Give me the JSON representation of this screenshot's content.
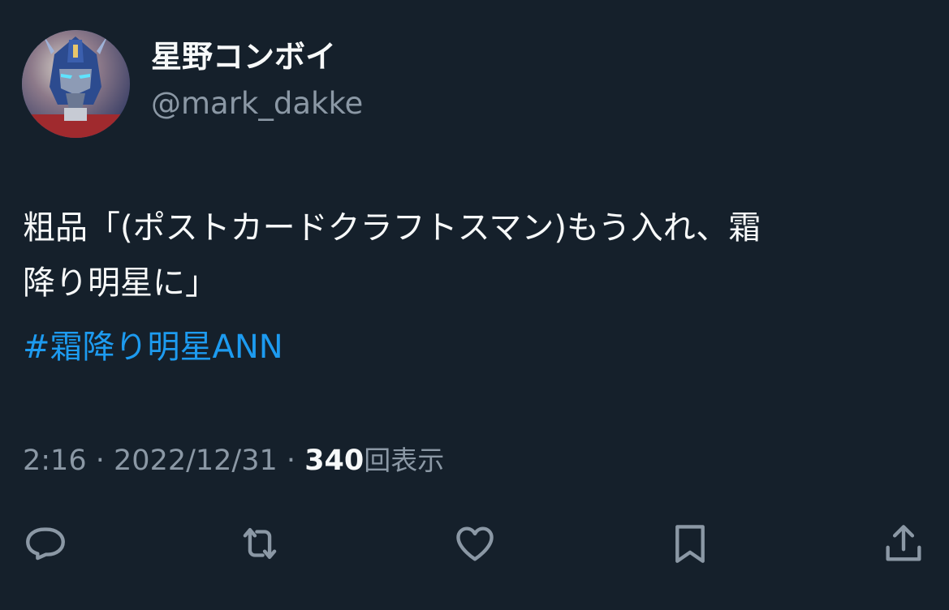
{
  "user": {
    "display_name": "星野コンボイ",
    "handle": "@mark_dakke",
    "avatar_icon": "robot-avatar"
  },
  "tweet": {
    "text_lines": [
      "粗品「(ポストカードクラフトスマン)もう入れ、霜",
      "降り明星に」"
    ],
    "hashtag": "#霜降り明星ANN"
  },
  "meta": {
    "time": "2:16",
    "separator": "·",
    "date": "2022/12/31",
    "views_count": "340",
    "views_label": "回表示"
  },
  "actions": [
    {
      "name": "reply",
      "icon": "reply-icon"
    },
    {
      "name": "retweet",
      "icon": "retweet-icon"
    },
    {
      "name": "like",
      "icon": "heart-icon"
    },
    {
      "name": "bookmark",
      "icon": "bookmark-icon"
    },
    {
      "name": "share",
      "icon": "share-icon"
    }
  ],
  "colors": {
    "background": "#15202b",
    "text": "#f7f9f9",
    "secondary": "#8b98a5",
    "link": "#1d9bf0"
  }
}
